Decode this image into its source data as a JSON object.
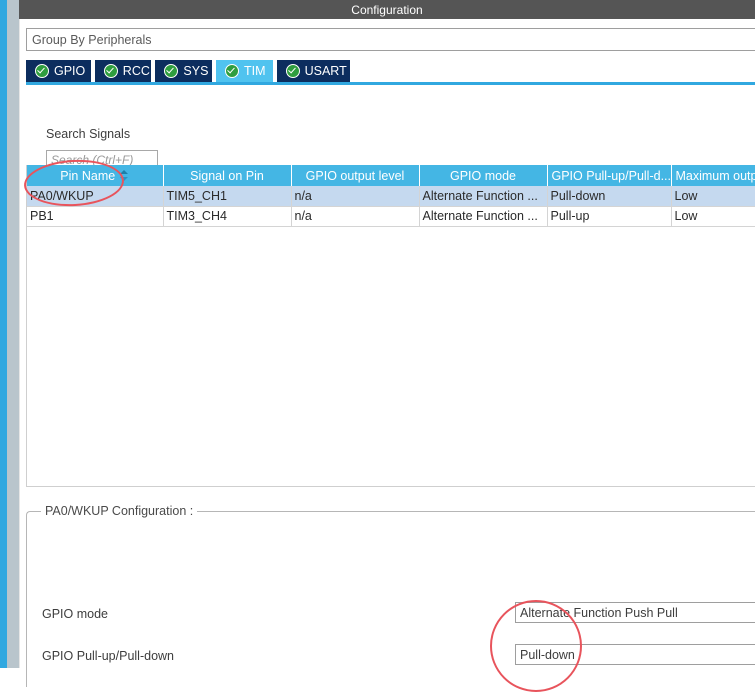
{
  "window": {
    "title": "Configuration"
  },
  "toolbar": {
    "group_by_value": "Group By Peripherals"
  },
  "tabs": [
    {
      "label": "GPIO",
      "icon": "check-circle-icon",
      "active": false
    },
    {
      "label": "RCC",
      "icon": "check-circle-icon",
      "active": false
    },
    {
      "label": "SYS",
      "icon": "check-circle-icon",
      "active": false
    },
    {
      "label": "TIM",
      "icon": "check-circle-icon",
      "active": true
    },
    {
      "label": "USART",
      "icon": "check-circle-icon",
      "active": false
    }
  ],
  "search": {
    "label": "Search Signals",
    "placeholder": "Search (Ctrl+F)",
    "value": ""
  },
  "table": {
    "columns": [
      {
        "label": "Pin Name",
        "sorted": true,
        "sort_icon": "sort-indicator-icon"
      },
      {
        "label": "Signal on Pin",
        "sorted": false
      },
      {
        "label": "GPIO output level",
        "sorted": false
      },
      {
        "label": "GPIO mode",
        "sorted": false
      },
      {
        "label": "GPIO Pull-up/Pull-d...",
        "sorted": false
      },
      {
        "label": "Maximum output s",
        "sorted": false
      }
    ],
    "rows": [
      {
        "selected": true,
        "cells": [
          "PA0/WKUP",
          "TIM5_CH1",
          "n/a",
          "Alternate Function ...",
          "Pull-down",
          "Low"
        ]
      },
      {
        "selected": false,
        "cells": [
          "PB1",
          "TIM3_CH4",
          "n/a",
          "Alternate Function ...",
          "Pull-up",
          "Low"
        ]
      }
    ]
  },
  "config_group": {
    "legend": "PA0/WKUP Configuration :",
    "fields": [
      {
        "label": "GPIO mode",
        "value": "Alternate Function Push Pull"
      },
      {
        "label": "GPIO Pull-up/Pull-down",
        "value": "Pull-down"
      }
    ]
  },
  "annotations": [
    {
      "name": "pin-name-highlight",
      "shape": "ellipse",
      "color": "#e8545c"
    },
    {
      "name": "pull-down-highlight",
      "shape": "ellipse",
      "color": "#e8545c"
    }
  ],
  "colors": {
    "accent": "#31a8e0",
    "tab_active": "#50c3ef",
    "tab_inactive": "#0c2d5e",
    "table_header": "#44b6e4",
    "row_selected": "#c5d9ef",
    "titlebar": "#555555",
    "annotation": "#e8545c"
  }
}
